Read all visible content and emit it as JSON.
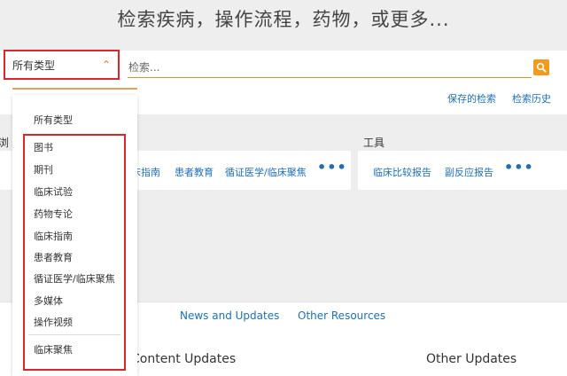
{
  "hero": {
    "title": "检索疾病，操作流程，药物，或更多..."
  },
  "search": {
    "type_selected": "所有类型",
    "placeholder": "检索...",
    "saved_searches": "保存的检索",
    "search_history": "检索历史"
  },
  "dropdown": {
    "all_types": "所有类型",
    "items": [
      "图书",
      "期刊",
      "临床试验",
      "药物专论",
      "临床指南",
      "患者教育",
      "循证医学/临床聚焦",
      "多媒体",
      "操作视频",
      "临床聚焦"
    ]
  },
  "browse": {
    "left_title_fragment": "浏",
    "left_links": [
      "床指南",
      "患者教育",
      "循证医学/临床聚焦"
    ],
    "more": "•••",
    "tools_title": "工具",
    "tools_links": [
      "临床比较报告",
      "副反应报告"
    ]
  },
  "bottom": {
    "tabs": [
      "News and Updates",
      "Other Resources"
    ],
    "content_updates": "Content Updates",
    "other_updates": "Other Updates"
  },
  "colors": {
    "accent_orange": "#f39a1e",
    "link_blue": "#1f6fb2",
    "highlight_red": "#d9262c"
  }
}
